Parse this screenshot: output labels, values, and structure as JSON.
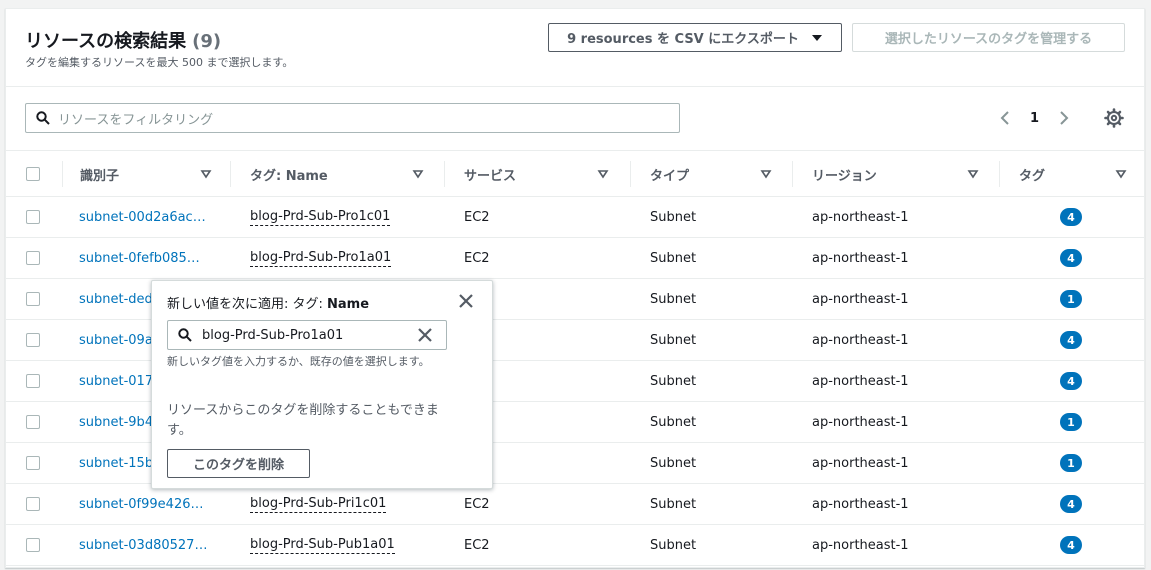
{
  "header": {
    "title": "リソースの検索結果",
    "count": "(9)",
    "subtitle": "タグを編集するリソースを最大 500 まで選択します。",
    "export_button": "9 resources を CSV にエクスポート",
    "manage_button": "選択したリソースのタグを管理する"
  },
  "filter": {
    "placeholder": "リソースをフィルタリング"
  },
  "pagination": {
    "current_page": "1"
  },
  "columns": {
    "identifier": "識別子",
    "tag_name": "タグ: Name",
    "service": "サービス",
    "type": "タイプ",
    "region": "リージョン",
    "tags": "タグ"
  },
  "rows": [
    {
      "id": "subnet-00d2a6ac…",
      "tag_name": "blog-Prd-Sub-Pro1c01",
      "service": "EC2",
      "type": "Subnet",
      "region": "ap-northeast-1",
      "tags": "4"
    },
    {
      "id": "subnet-0fefb085…",
      "tag_name": "blog-Prd-Sub-Pro1a01",
      "service": "EC2",
      "type": "Subnet",
      "region": "ap-northeast-1",
      "tags": "4"
    },
    {
      "id": "subnet-ded",
      "tag_name": "",
      "service": "",
      "type": "Subnet",
      "region": "ap-northeast-1",
      "tags": "1"
    },
    {
      "id": "subnet-09a",
      "tag_name": "",
      "service": "",
      "type": "Subnet",
      "region": "ap-northeast-1",
      "tags": "4"
    },
    {
      "id": "subnet-017",
      "tag_name": "",
      "service": "",
      "type": "Subnet",
      "region": "ap-northeast-1",
      "tags": "4"
    },
    {
      "id": "subnet-9b4",
      "tag_name": "",
      "service": "",
      "type": "Subnet",
      "region": "ap-northeast-1",
      "tags": "1"
    },
    {
      "id": "subnet-15b",
      "tag_name": "",
      "service": "",
      "type": "Subnet",
      "region": "ap-northeast-1",
      "tags": "1"
    },
    {
      "id": "subnet-0f99e426…",
      "tag_name": "blog-Prd-Sub-Pri1c01",
      "service": "EC2",
      "type": "Subnet",
      "region": "ap-northeast-1",
      "tags": "4"
    },
    {
      "id": "subnet-03d80527…",
      "tag_name": "blog-Prd-Sub-Pub1a01",
      "service": "EC2",
      "type": "Subnet",
      "region": "ap-northeast-1",
      "tags": "4"
    }
  ],
  "popover": {
    "title_prefix": "新しい値を次に適用: タグ: ",
    "title_key": "Name",
    "input_value": "blog-Prd-Sub-Pro1a01",
    "hint": "新しいタグ値を入力するか、既存の値を選択します。",
    "description": "リソースからこのタグを削除することもできます。",
    "delete_button": "このタグを削除"
  },
  "colors": {
    "link": "#0073bb",
    "badge": "#0073bb",
    "text": "#16191f",
    "secondary": "#545b64",
    "border": "#eaeded"
  }
}
